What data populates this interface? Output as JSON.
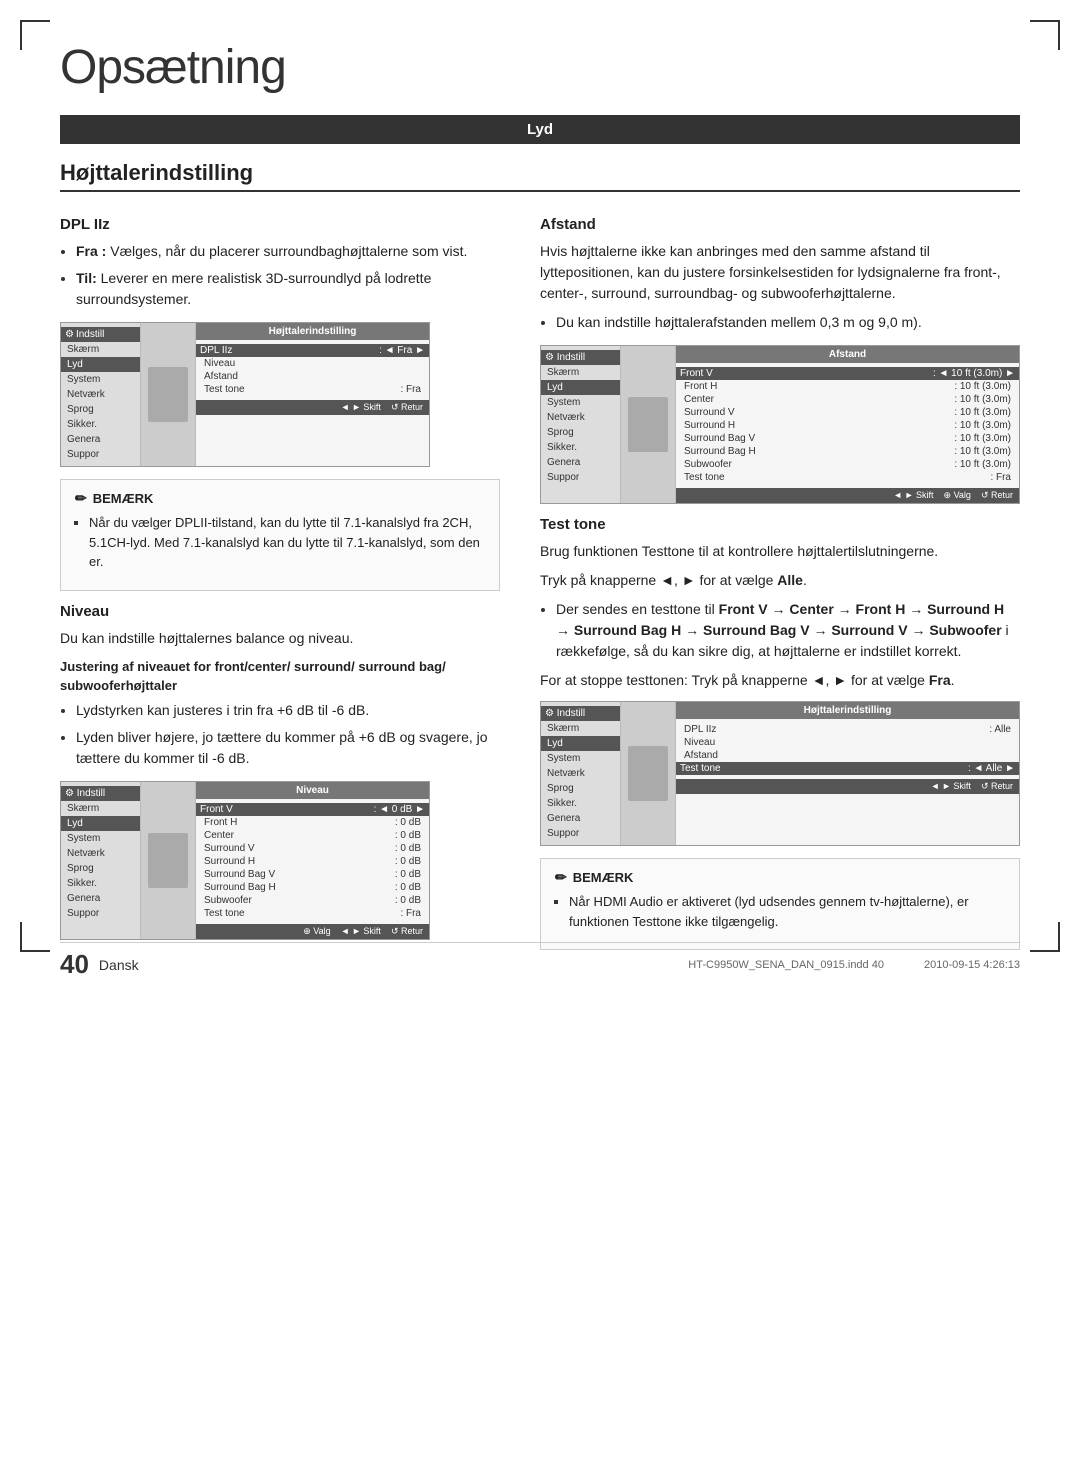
{
  "page": {
    "title": "Opsætning",
    "language": "Dansk",
    "page_number": "40",
    "footer_file": "HT-C9950W_SENA_DAN_0915.indd  40",
    "footer_date": "2010-09-15  4:26:13"
  },
  "lyd_header": "Lyd",
  "main_section": {
    "title": "Højttalerindstilling",
    "dpl_section": {
      "title": "DPL IIz",
      "bullets": [
        "Fra : Vælges, når du placerer surroundbaghøjttalerne som vist.",
        "Til: Leverer en mere realistisk 3D-surroundlyd på lodrette surroundsystemer."
      ]
    },
    "bemerk1": {
      "title": "BEMÆRK",
      "items": [
        "Når du vælger DPLII-tilstand, kan du lytte til 7.1-kanalslyd fra 2CH, 5.1CH-lyd. Med 7.1-kanalslyd kan du lytte til 7.1-kanalslyd, som den er."
      ]
    },
    "niveau_section": {
      "title": "Niveau",
      "intro": "Du kan indstille højttalernes balance og niveau.",
      "subtitle": "Justering af niveauet for front/center/ surround/ surround bag/ subwooferhøjttaler",
      "bullets": [
        "Lydstyrken kan justeres i trin fra +6 dB til -6 dB.",
        "Lyden bliver højere, jo tættere du kommer på +6 dB og svagere, jo tættere du kommer til -6 dB."
      ]
    },
    "afstand_section": {
      "title": "Afstand",
      "intro": "Hvis højttalerne ikke kan anbringes med den samme afstand til lyttepositionen, kan du justere forsinkelsestiden for lydsignalerne fra front-, center-, surround, surroundbag- og subwooferhøjttalerne.",
      "bullet": "Du kan indstille højttalerafstanden mellem 0,3 m og 9,0 m)."
    },
    "test_tone_section": {
      "title": "Test tone",
      "intro": "Brug funktionen Testtone til at kontrollere højttalertilslutningerne.",
      "instruction1": "Tryk på knapperne ◄, ► for at vælge Alle.",
      "arrow_sequence": "Der sendes en testtone til Front V → Center → Front H → Surround H → Surround Bag H → Surround Bag V → Surround V → Subwoofer i rækkefølge, så du kan sikre dig, at højttalerne er indstillet korrekt.",
      "instruction2": "For at stoppe testtonen: Tryk på knapperne ◄, ► for at vælge Fra."
    },
    "bemerk2": {
      "title": "BEMÆRK",
      "items": [
        "Når HDMI Audio er aktiveret (lyd udsendes gennem tv-højttalerne), er funktionen Testtone ikke tilgængelig."
      ]
    }
  },
  "screens": {
    "dpl_screen": {
      "gear_label": "Indstill",
      "content_title": "Højttalerindstilling",
      "sidebar_items": [
        "Skærm",
        "Lyd",
        "System",
        "Netværk",
        "Sprog",
        "Sikker.",
        "Genera",
        "Suppor"
      ],
      "active_item": "Lyd",
      "menu_items": [
        {
          "label": "DPL IIz",
          "value": "◄ Fra ►"
        },
        {
          "label": "Niveau",
          "value": ""
        },
        {
          "label": "Afstand",
          "value": ""
        },
        {
          "label": "Test tone",
          "value": "Fra"
        }
      ],
      "highlighted": "DPL IIz",
      "footer_items": [
        "◄ ► Skift",
        "↺ Retur"
      ]
    },
    "niveau_screen": {
      "gear_label": "Indstill",
      "content_title": "Niveau",
      "sidebar_items": [
        "Skærm",
        "Lyd",
        "System",
        "Netværk",
        "Sprog",
        "Sikker.",
        "Genera",
        "Suppor"
      ],
      "active_item": "Lyd",
      "rows": [
        {
          "label": "Front V",
          "value": "◄ 0 dB ►"
        },
        {
          "label": "Front H",
          "value": "0 dB"
        },
        {
          "label": "Center",
          "value": "0 dB"
        },
        {
          "label": "Surround V",
          "value": "0 dB"
        },
        {
          "label": "Surround H",
          "value": "0 dB"
        },
        {
          "label": "Surround Bag V",
          "value": "0 dB"
        },
        {
          "label": "Surround Bag H",
          "value": "0 dB"
        },
        {
          "label": "Subwoofer",
          "value": "0 dB"
        },
        {
          "label": "Test tone",
          "value": "Fra"
        }
      ],
      "highlighted": "Front V",
      "footer_items": [
        "⊕ Valg",
        "◄ ► Skift",
        "↺ Retur"
      ]
    },
    "afstand_screen": {
      "gear_label": "Indstill",
      "content_title": "Afstand",
      "sidebar_items": [
        "Skærm",
        "Lyd",
        "System",
        "Netværk",
        "Sprog",
        "Sikker.",
        "Genera",
        "Suppor"
      ],
      "active_item": "Lyd",
      "rows": [
        {
          "label": "Front V",
          "value": "◄ 10 ft (3.0m) ►"
        },
        {
          "label": "Front H",
          "value": "10 ft (3.0m)"
        },
        {
          "label": "Center",
          "value": "10 ft (3.0m)"
        },
        {
          "label": "Surround V",
          "value": "10 ft (3.0m)"
        },
        {
          "label": "Surround H",
          "value": "10 ft (3.0m)"
        },
        {
          "label": "Surround Bag V",
          "value": "10 ft (3.0m)"
        },
        {
          "label": "Surround Bag H",
          "value": "10 ft (3.0m)"
        },
        {
          "label": "Subwoofer",
          "value": "10 ft (3.0m)"
        },
        {
          "label": "Test tone",
          "value": "Fra"
        }
      ],
      "highlighted": "Front V",
      "footer_items": [
        "◄ ► Skift",
        "⊕ Valg",
        "↺ Retur"
      ]
    },
    "test_tone_screen": {
      "gear_label": "Indstill",
      "content_title": "Højttalerindstilling",
      "sidebar_items": [
        "Skærm",
        "Lyd",
        "System",
        "Netværk",
        "Sprog",
        "Sikker.",
        "Genera",
        "Suppor"
      ],
      "active_item": "Lyd",
      "menu_items": [
        {
          "label": "DPL IIz",
          "value": "Alle"
        },
        {
          "label": "Niveau",
          "value": ""
        },
        {
          "label": "Afstand",
          "value": ""
        },
        {
          "label": "Test tone",
          "value": "◄ Alle ►"
        }
      ],
      "highlighted": "Test tone",
      "footer_items": [
        "◄ ► Skift",
        "↺ Retur"
      ]
    }
  }
}
